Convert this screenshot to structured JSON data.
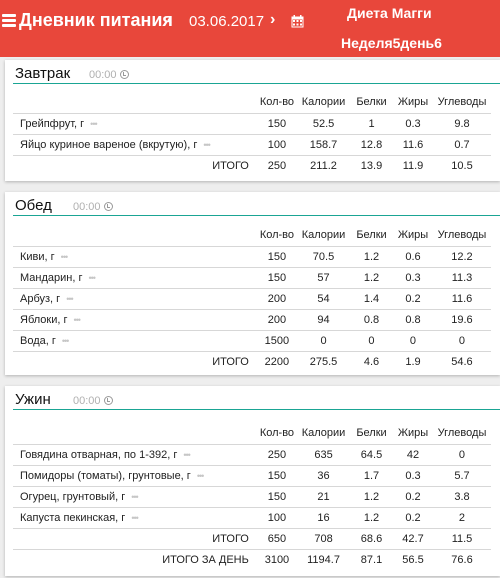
{
  "header": {
    "app_title": "Дневник питания",
    "prev_arrow": "‹",
    "date": "03.06.2017",
    "next_arrow": "›",
    "diet_name": "Диета Магги",
    "diet_week": "Неделя5день6",
    "accent_color": "#e8473b"
  },
  "columns": {
    "qty": "Кол-во",
    "calories": "Калории",
    "protein": "Белки",
    "fat": "Жиры",
    "carbs": "Углеводы"
  },
  "meals": [
    {
      "title": "Завтрак",
      "time": "00:00",
      "rows": [
        {
          "name": "Грейпфрут, г",
          "qty": "150",
          "cal": "52.5",
          "p": "1",
          "f": "0.3",
          "c": "9.8"
        },
        {
          "name": "Яйцо куриное вареное (вкрутую), г",
          "qty": "100",
          "cal": "158.7",
          "p": "12.8",
          "f": "11.6",
          "c": "0.7"
        }
      ],
      "total": {
        "label": "ИТОГО",
        "qty": "250",
        "cal": "211.2",
        "p": "13.9",
        "f": "11.9",
        "c": "10.5"
      }
    },
    {
      "title": "Обед",
      "time": "00:00",
      "rows": [
        {
          "name": "Киви, г",
          "qty": "150",
          "cal": "70.5",
          "p": "1.2",
          "f": "0.6",
          "c": "12.2"
        },
        {
          "name": "Мандарин, г",
          "qty": "150",
          "cal": "57",
          "p": "1.2",
          "f": "0.3",
          "c": "11.3"
        },
        {
          "name": "Арбуз, г",
          "qty": "200",
          "cal": "54",
          "p": "1.4",
          "f": "0.2",
          "c": "11.6"
        },
        {
          "name": "Яблоки, г",
          "qty": "200",
          "cal": "94",
          "p": "0.8",
          "f": "0.8",
          "c": "19.6"
        },
        {
          "name": "Вода, г",
          "qty": "1500",
          "cal": "0",
          "p": "0",
          "f": "0",
          "c": "0"
        }
      ],
      "total": {
        "label": "ИТОГО",
        "qty": "2200",
        "cal": "275.5",
        "p": "4.6",
        "f": "1.9",
        "c": "54.6"
      }
    },
    {
      "title": "Ужин",
      "time": "00:00",
      "rows": [
        {
          "name": "Говядина отварная, по 1-392, г",
          "qty": "250",
          "cal": "635",
          "p": "64.5",
          "f": "42",
          "c": "0"
        },
        {
          "name": "Помидоры (томаты), грунтовые, г",
          "qty": "150",
          "cal": "36",
          "p": "1.7",
          "f": "0.3",
          "c": "5.7"
        },
        {
          "name": "Огурец, грунтовый, г",
          "qty": "150",
          "cal": "21",
          "p": "1.2",
          "f": "0.2",
          "c": "3.8"
        },
        {
          "name": "Капуста пекинская, г",
          "qty": "100",
          "cal": "16",
          "p": "1.2",
          "f": "0.2",
          "c": "2"
        }
      ],
      "total": {
        "label": "ИТОГО",
        "qty": "650",
        "cal": "708",
        "p": "68.6",
        "f": "42.7",
        "c": "11.5"
      }
    }
  ],
  "day_total": {
    "label": "ИТОГО ЗА ДЕНЬ",
    "qty": "3100",
    "cal": "1194.7",
    "p": "87.1",
    "f": "56.5",
    "c": "76.6"
  },
  "icons": {
    "menu": "hamburger-icon",
    "calendar": "calendar-icon",
    "clock": "clock-icon",
    "more": "more-dots-icon",
    "more_glyph": "•••"
  }
}
